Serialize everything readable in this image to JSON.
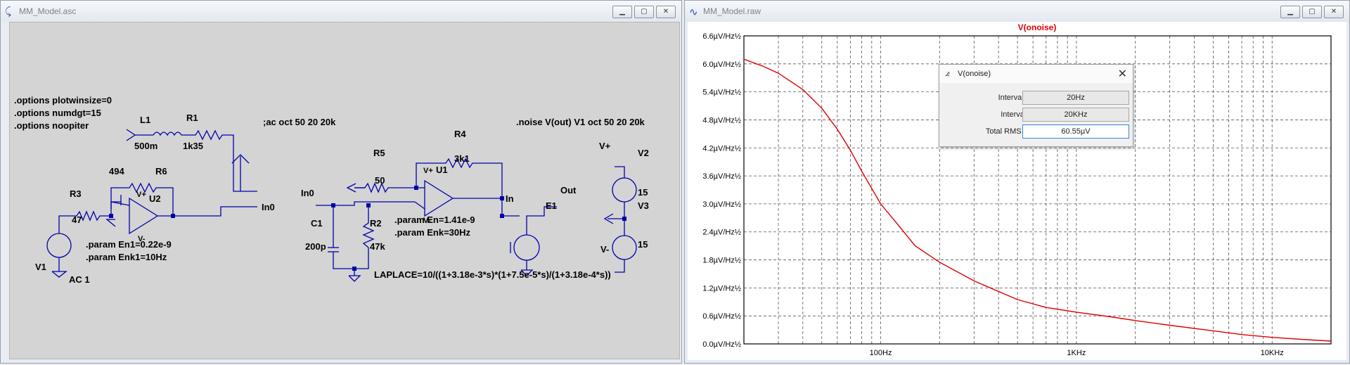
{
  "schematic_window": {
    "title": "MM_Model.asc",
    "labels": {
      "opt1": ".options plotwinsize=0",
      "opt2": ".options numdgt=15",
      "opt3": ".options noopiter",
      "ac": ";ac oct 50 20 20k",
      "noise": ".noise V(out) V1 oct 50 20 20k",
      "L1": "L1",
      "L1v": "500m",
      "R1": "R1",
      "R1v": "1k35",
      "R6v": "494",
      "R6": "R6",
      "R3": "R3",
      "R3v": "47",
      "U2": "U2",
      "V1": "V1",
      "AC1": "AC 1",
      "param_en1": ".param En1=0.22e-9",
      "param_enk1": ".param Enk1=10Hz",
      "In0a": "In0",
      "In0b": "In0",
      "R5": "R5",
      "R5v": "50",
      "R4": "R4",
      "R4v": "3k1",
      "U1": "U1",
      "C1": "C1",
      "C1v": "200p",
      "R2": "R2",
      "R2v": "47k",
      "param_en": ".param En=1.41e-9",
      "param_enk": ".param Enk=30Hz",
      "In": "In",
      "Out": "Out",
      "E1": "E1",
      "laplace": "LAPLACE=10/((1+3.18e-3*s)*(1+7.5e-5*s)/(1+3.18e-4*s))",
      "Vplus": "V+",
      "V2": "V2",
      "V2v": "15",
      "V3": "V3",
      "V3v": "15",
      "Vminus": "V-",
      "oa_vp1": "V+",
      "oa_vm1": "V-",
      "oa_vp2": "V+",
      "oa_vm2": "V-"
    }
  },
  "plot_window": {
    "title": "MM_Model.raw",
    "trace_name": "V(onoise)",
    "trace_color": "#e00000"
  },
  "chart_data": {
    "type": "line",
    "title": "V(onoise)",
    "xscale": "log",
    "xlim": [
      20,
      20000
    ],
    "ylim": [
      0,
      6.6
    ],
    "grid": true,
    "xtick_labels": [
      "100Hz",
      "1KHz",
      "10KHz"
    ],
    "ytick_labels": [
      "6.6µV/Hz½",
      "6.0µV/Hz½",
      "5.4µV/Hz½",
      "4.8µV/Hz½",
      "4.2µV/Hz½",
      "3.6µV/Hz½",
      "3.0µV/Hz½",
      "2.4µV/Hz½",
      "1.8µV/Hz½",
      "1.2µV/Hz½",
      "0.6µV/Hz½",
      "0.0µV/Hz½"
    ],
    "series": [
      {
        "name": "V(onoise)",
        "x": [
          20,
          25,
          30,
          40,
          50,
          60,
          70,
          80,
          100,
          120,
          150,
          200,
          300,
          500,
          700,
          1000,
          1500,
          2000,
          3000,
          5000,
          7000,
          10000,
          15000,
          20000
        ],
        "y": [
          6.1,
          5.95,
          5.8,
          5.45,
          5.05,
          4.6,
          4.15,
          3.7,
          3.0,
          2.6,
          2.1,
          1.75,
          1.35,
          0.95,
          0.78,
          0.68,
          0.58,
          0.5,
          0.4,
          0.28,
          0.2,
          0.14,
          0.09,
          0.06
        ]
      }
    ]
  },
  "noise_dialog": {
    "title": "V(onoise)",
    "interval_start_label": "Interval Start:",
    "interval_start": "20Hz",
    "interval_end_label": "Interval End:",
    "interval_end": "20KHz",
    "total_rms_label": "Total RMS noise:",
    "total_rms": "60.55µV"
  }
}
